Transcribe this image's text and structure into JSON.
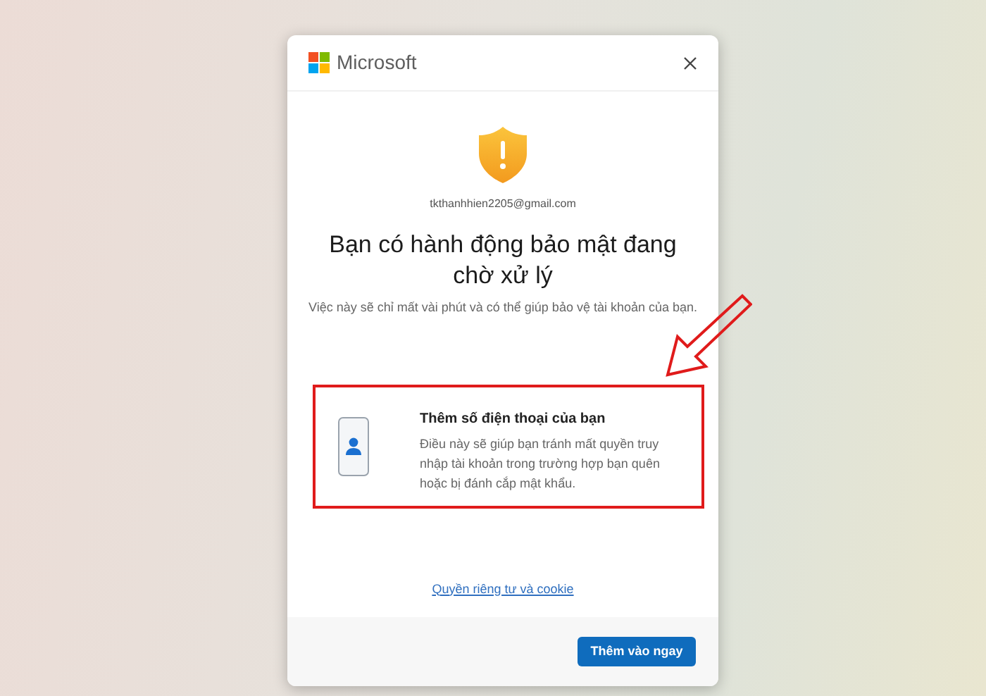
{
  "header": {
    "brand": "Microsoft"
  },
  "account": {
    "email": "tkthanhhien2205@gmail.com"
  },
  "heading": "Bạn có hành động bảo mật đang chờ xử lý",
  "subtitle": "Việc này sẽ chỉ mất vài phút và có thể giúp bảo vệ tài khoản của bạn.",
  "actions": [
    {
      "title": "Thêm số điện thoại của bạn",
      "description": "Điều này sẽ giúp bạn tránh mất quyền truy nhập tài khoản trong trường hợp bạn quên hoặc bị đánh cắp mật khẩu."
    }
  ],
  "privacy_link": "Quyền riêng tư và cookie",
  "primary_button": "Thêm vào ngay"
}
